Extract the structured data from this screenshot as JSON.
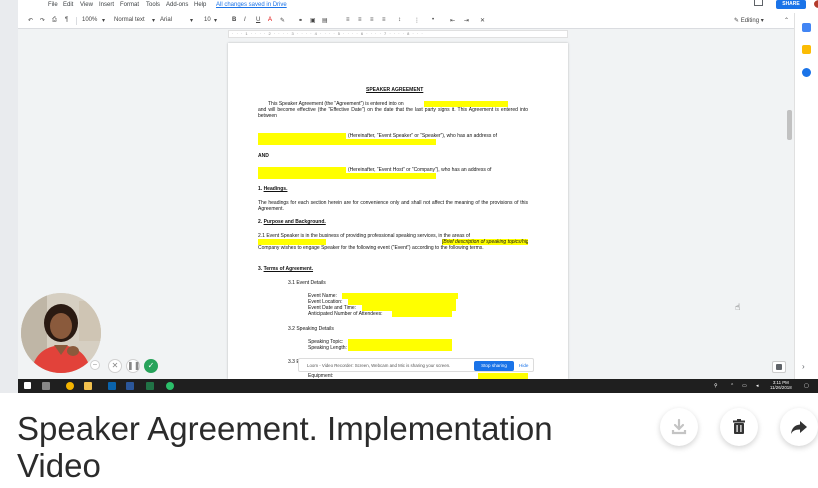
{
  "app": {
    "menus": [
      "File",
      "Edit",
      "View",
      "Insert",
      "Format",
      "Tools",
      "Add-ons",
      "Help"
    ],
    "save_status": "All changes saved in Drive",
    "share_label": "SHARE"
  },
  "toolbar": {
    "zoom": "100%",
    "style": "Normal text",
    "font": "Arial",
    "size": "10",
    "mode": "Editing"
  },
  "document": {
    "title": "SPEAKER AGREEMENT",
    "intro_a": "This Speaker Agreement (the “Agreement”) is entered into on",
    "intro_b": "and will become effective (the “Effective Date”) on the date that the last party signs it. This Agreement is entered into between",
    "speaker_line": "(Hereinafter, “Event Speaker” or “Speaker”), who has an address of",
    "and": "AND",
    "host_line": "(Hereinafter, “Event Host” or “Company”), who has an address of",
    "s1_num": "1.",
    "s1_title": "Headings.",
    "s1_text": "The headings for each section herein are for convenience only and shall not affect the meaning of the provisions of this Agreement.",
    "s2_num": "2.",
    "s2_title": "Purpose and Background.",
    "s2_text_a": "2.1 Event Speaker is in the business of providing professional speaking services, in the areas of",
    "s2_highlight": "[Brief description of speaking topics/highlights]",
    "s2_text_b": "Company wishes to engage Speaker for the following event (“Event”) according to the following terms.",
    "s3_num": "3.",
    "s3_title": "Terms of Agreement.",
    "s31": "3.1 Event Details",
    "event_fields": [
      "Event Name:",
      "Event Location:",
      "Event Date and Time:",
      "Anticipated Number of Attendees:"
    ],
    "s32": "3.2 Speaking Details",
    "speaking_fields": [
      "Speaking Topic:",
      "Speaking Length:"
    ],
    "s33": "3.3 E",
    "equipment": "Equipment:"
  },
  "loom": {
    "share_text": "Loom - Video Recorder: Screen, Webcam and Mic is sharing your screen.",
    "stop_label": "Stop sharing",
    "hide_label": "Hide"
  },
  "taskbar": {
    "time": "3:11 PM",
    "date": "11/26/2018"
  },
  "video": {
    "title": "Speaker Agreement. Implementation Video"
  },
  "colors": {
    "highlight": "#ffff00",
    "accent": "#1a73e8",
    "confirm": "#27a35a"
  }
}
